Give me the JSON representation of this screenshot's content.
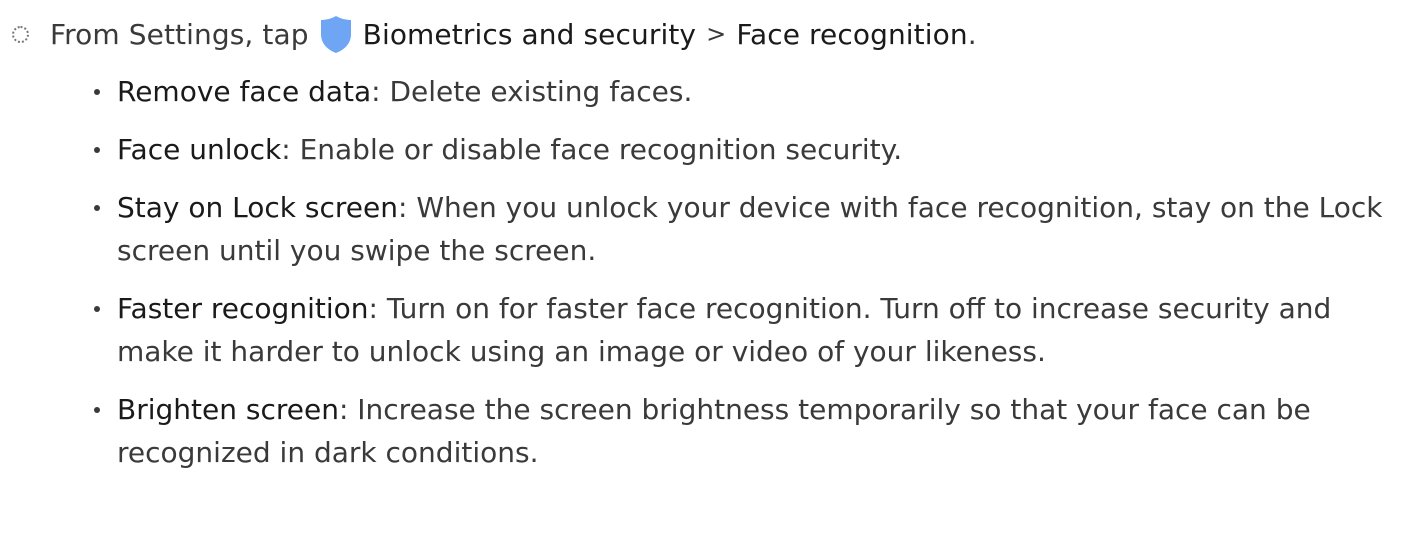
{
  "step": {
    "prefix": "From Settings, tap",
    "menu_item": "Biometrics and security",
    "separator": ">",
    "submenu_item": "Face recognition",
    "suffix": ".",
    "icon": "shield-icon",
    "icon_color": "#6ea6f5"
  },
  "options": [
    {
      "name": "Remove face data",
      "description": ": Delete existing faces."
    },
    {
      "name": "Face unlock",
      "description": ": Enable or disable face recognition security."
    },
    {
      "name": "Stay on Lock screen",
      "description": ": When you unlock your device with face recognition, stay on the Lock screen until you swipe the screen."
    },
    {
      "name": "Faster recognition",
      "description": ": Turn on for faster face recognition. Turn off to increase security and make it harder to unlock using an image or video of your likeness."
    },
    {
      "name": "Brighten screen",
      "description": ": Increase the screen brightness temporarily so that your face can be recognized in dark conditions."
    }
  ]
}
